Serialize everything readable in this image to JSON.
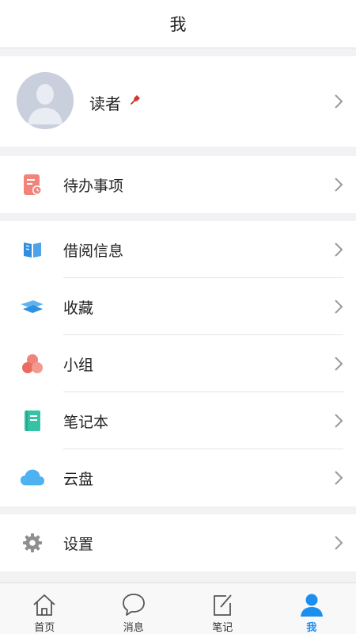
{
  "header": {
    "title": "我"
  },
  "profile": {
    "name": "读者",
    "pin_color": "#d33a2f"
  },
  "todo": {
    "label": "待办事项",
    "icon": "todo-list-icon"
  },
  "menu_group": [
    {
      "key": "borrow",
      "label": "借阅信息",
      "icon": "book-icon"
    },
    {
      "key": "favorites",
      "label": "收藏",
      "icon": "collect-icon"
    },
    {
      "key": "groups",
      "label": "小组",
      "icon": "group-icon"
    },
    {
      "key": "notebook",
      "label": "笔记本",
      "icon": "notebook-icon"
    },
    {
      "key": "cloud",
      "label": "云盘",
      "icon": "cloud-icon"
    }
  ],
  "settings": {
    "label": "设置",
    "icon": "gear-icon"
  },
  "tabbar": {
    "active": "me",
    "active_color": "#1a8ff0",
    "items": [
      {
        "key": "home",
        "label": "首页",
        "icon": "home-icon"
      },
      {
        "key": "messages",
        "label": "消息",
        "icon": "message-icon"
      },
      {
        "key": "notes",
        "label": "笔记",
        "icon": "note-edit-icon"
      },
      {
        "key": "me",
        "label": "我",
        "icon": "user-icon"
      }
    ]
  }
}
